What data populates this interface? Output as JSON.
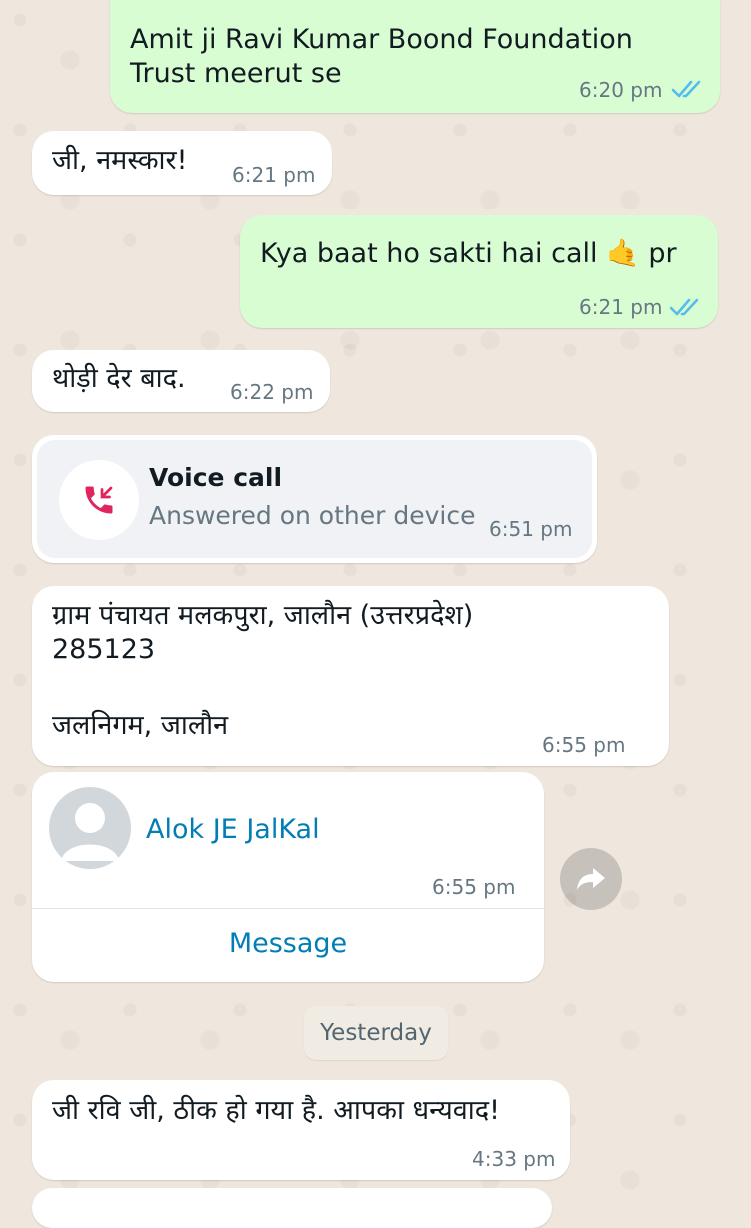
{
  "messages": [
    {
      "direction": "outgoing",
      "text_line1": "Amit ji Ravi Kumar Boond Foundation",
      "text_line2": "Trust meerut se",
      "time": "6:20 pm",
      "status": "read"
    },
    {
      "direction": "incoming",
      "text": "जी, नमस्कार!",
      "time": "6:21 pm"
    },
    {
      "direction": "outgoing",
      "text": "Kya baat ho sakti hai call",
      "emoji": "🤙",
      "text_suffix": "pr",
      "time": "6:21 pm",
      "status": "read"
    },
    {
      "direction": "incoming",
      "text": "थोड़ी देर बाद.",
      "time": "6:22 pm"
    },
    {
      "direction": "incoming",
      "type": "call",
      "title": "Voice call",
      "subtitle": "Answered on other device",
      "time": "6:51 pm"
    },
    {
      "direction": "incoming",
      "text_line1": "ग्राम पंचायत मलकपुरा, जालौन (उत्तरप्रदेश)",
      "text_line2": "285123",
      "text_line3": "जलनिगम, जालौन",
      "time": "6:55 pm"
    },
    {
      "direction": "incoming",
      "type": "contact",
      "name": "Alok JE JalKal",
      "time": "6:55 pm",
      "action": "Message"
    },
    {
      "direction": "incoming",
      "text": "जी रवि जी, ठीक हो गया है. आपका धन्यवाद!",
      "time": "4:33 pm"
    }
  ],
  "date_separator": "Yesterday",
  "icons": {
    "read_ticks": "double-check-icon",
    "call": "incoming-call-icon",
    "avatar": "person-icon",
    "forward": "forward-icon"
  },
  "colors": {
    "outgoing_bubble": "#d9fdd3",
    "incoming_bubble": "#ffffff",
    "read_tick": "#53bdeb",
    "link": "#027eb5",
    "call_icon": "#e0245e"
  }
}
